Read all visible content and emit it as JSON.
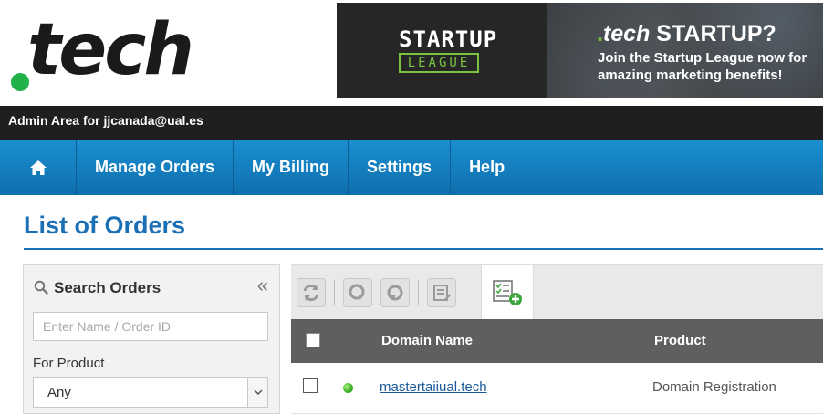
{
  "logo": {
    "text": "tech"
  },
  "banner": {
    "startup_top": "STARTUP",
    "startup_bottom": "LEAGUE",
    "headline_dot": ".",
    "headline_tech": "tech",
    "headline_rest": " STARTUP?",
    "subtext": "Join the Startup League now for amazing marketing benefits!",
    "accent_color": "#7cc242"
  },
  "admin_bar": {
    "text": "Admin Area for jjcanada@ual.es"
  },
  "nav": {
    "home_icon": "home-icon",
    "items": [
      {
        "label": "Manage Orders"
      },
      {
        "label": "My Billing"
      },
      {
        "label": "Settings"
      },
      {
        "label": "Help"
      }
    ],
    "color": "#1a8fd0"
  },
  "page": {
    "title": "List of Orders",
    "title_color": "#1a6fb5"
  },
  "search": {
    "title": "Search Orders",
    "collapse_glyph": "«",
    "input_placeholder": "Enter Name / Order ID",
    "product_label": "For Product",
    "product_value": "Any"
  },
  "toolbar": {
    "buttons": [
      "refresh-icon",
      "suspend-icon",
      "unsuspend-icon",
      "details-icon",
      "add-order-icon"
    ]
  },
  "table": {
    "headers": {
      "domain": "Domain Name",
      "product": "Product"
    },
    "rows": [
      {
        "domain": "mastertaiiual.tech",
        "product": "Domain Registration",
        "status": "active"
      }
    ]
  }
}
